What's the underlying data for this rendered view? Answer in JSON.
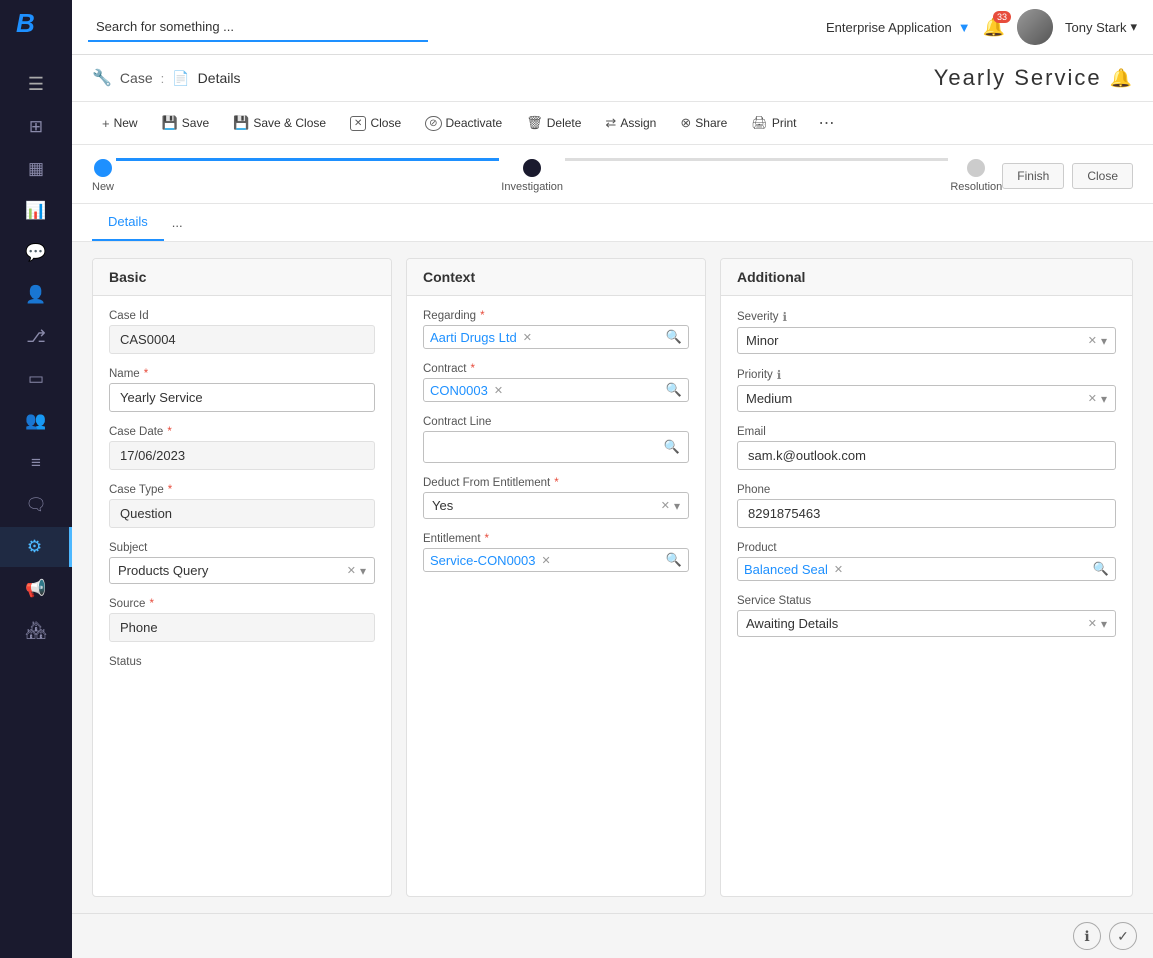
{
  "app": {
    "title": "Enterprise Application",
    "user_name": "Tony Stark",
    "search_placeholder": "Search for something ...",
    "notification_count": "33"
  },
  "sidebar": {
    "logo": "B",
    "menu_icon": "☰",
    "nav_items": [
      {
        "id": "dashboard",
        "icon": "⊞",
        "active": false
      },
      {
        "id": "calendar",
        "icon": "📅",
        "active": false
      },
      {
        "id": "reports",
        "icon": "📊",
        "active": false
      },
      {
        "id": "chat",
        "icon": "💬",
        "active": false
      },
      {
        "id": "user",
        "icon": "👤",
        "active": false
      },
      {
        "id": "git",
        "icon": "⎇",
        "active": false
      },
      {
        "id": "wallet",
        "icon": "💳",
        "active": false
      },
      {
        "id": "team",
        "icon": "👥",
        "active": false
      },
      {
        "id": "list",
        "icon": "☰",
        "active": false
      },
      {
        "id": "msg",
        "icon": "🗨",
        "active": false
      },
      {
        "id": "wrench",
        "icon": "🔧",
        "active": true
      },
      {
        "id": "megaphone",
        "icon": "📢",
        "active": false
      },
      {
        "id": "people",
        "icon": "🏘",
        "active": false
      }
    ]
  },
  "breadcrumb": {
    "entity": "Case",
    "view": "Details"
  },
  "page_title": "Yearly Service",
  "toolbar": {
    "buttons": [
      {
        "id": "new",
        "icon": "+",
        "label": "New"
      },
      {
        "id": "save",
        "icon": "💾",
        "label": "Save"
      },
      {
        "id": "save-close",
        "icon": "💾",
        "label": "Save & Close"
      },
      {
        "id": "close",
        "icon": "✕",
        "label": "Close"
      },
      {
        "id": "deactivate",
        "icon": "⊘",
        "label": "Deactivate"
      },
      {
        "id": "delete",
        "icon": "🗑",
        "label": "Delete"
      },
      {
        "id": "assign",
        "icon": "⇄",
        "label": "Assign"
      },
      {
        "id": "share",
        "icon": "⊗",
        "label": "Share"
      },
      {
        "id": "print",
        "icon": "🖨",
        "label": "Print"
      }
    ],
    "more_label": "⋯"
  },
  "progress": {
    "steps": [
      {
        "id": "new",
        "label": "New",
        "state": "completed"
      },
      {
        "id": "investigation",
        "label": "Investigation",
        "state": "current"
      },
      {
        "id": "resolution",
        "label": "Resolution",
        "state": "inactive"
      }
    ],
    "actions": [
      {
        "id": "finish",
        "label": "Finish"
      },
      {
        "id": "close",
        "label": "Close"
      }
    ]
  },
  "tabs": [
    {
      "id": "details",
      "label": "Details",
      "active": true
    },
    {
      "id": "more",
      "label": "..."
    }
  ],
  "sections": {
    "basic": {
      "title": "Basic",
      "fields": {
        "case_id_label": "Case Id",
        "case_id_value": "CAS0004",
        "name_label": "Name",
        "name_value": "Yearly Service",
        "case_date_label": "Case Date",
        "case_date_value": "17/06/2023",
        "case_type_label": "Case Type",
        "case_type_value": "Question",
        "subject_label": "Subject",
        "subject_value": "Products Query",
        "source_label": "Source",
        "source_value": "Phone",
        "status_label": "Status"
      }
    },
    "context": {
      "title": "Context",
      "fields": {
        "regarding_label": "Regarding",
        "regarding_value": "Aarti Drugs Ltd",
        "contract_label": "Contract",
        "contract_value": "CON0003",
        "contract_line_label": "Contract Line",
        "contract_line_value": "",
        "deduct_label": "Deduct From Entitlement",
        "deduct_value": "Yes",
        "entitlement_label": "Entitlement",
        "entitlement_value": "Service-CON0003"
      }
    },
    "additional": {
      "title": "Additional",
      "fields": {
        "severity_label": "Severity",
        "severity_value": "Minor",
        "priority_label": "Priority",
        "priority_value": "Medium",
        "email_label": "Email",
        "email_value": "sam.k@outlook.com",
        "phone_label": "Phone",
        "phone_value": "8291875463",
        "product_label": "Product",
        "product_value": "Balanced Seal",
        "service_status_label": "Service Status",
        "service_status_value": "Awaiting Details"
      }
    }
  },
  "bottom_icons": {
    "info_label": "ℹ",
    "shield_label": "✓"
  }
}
